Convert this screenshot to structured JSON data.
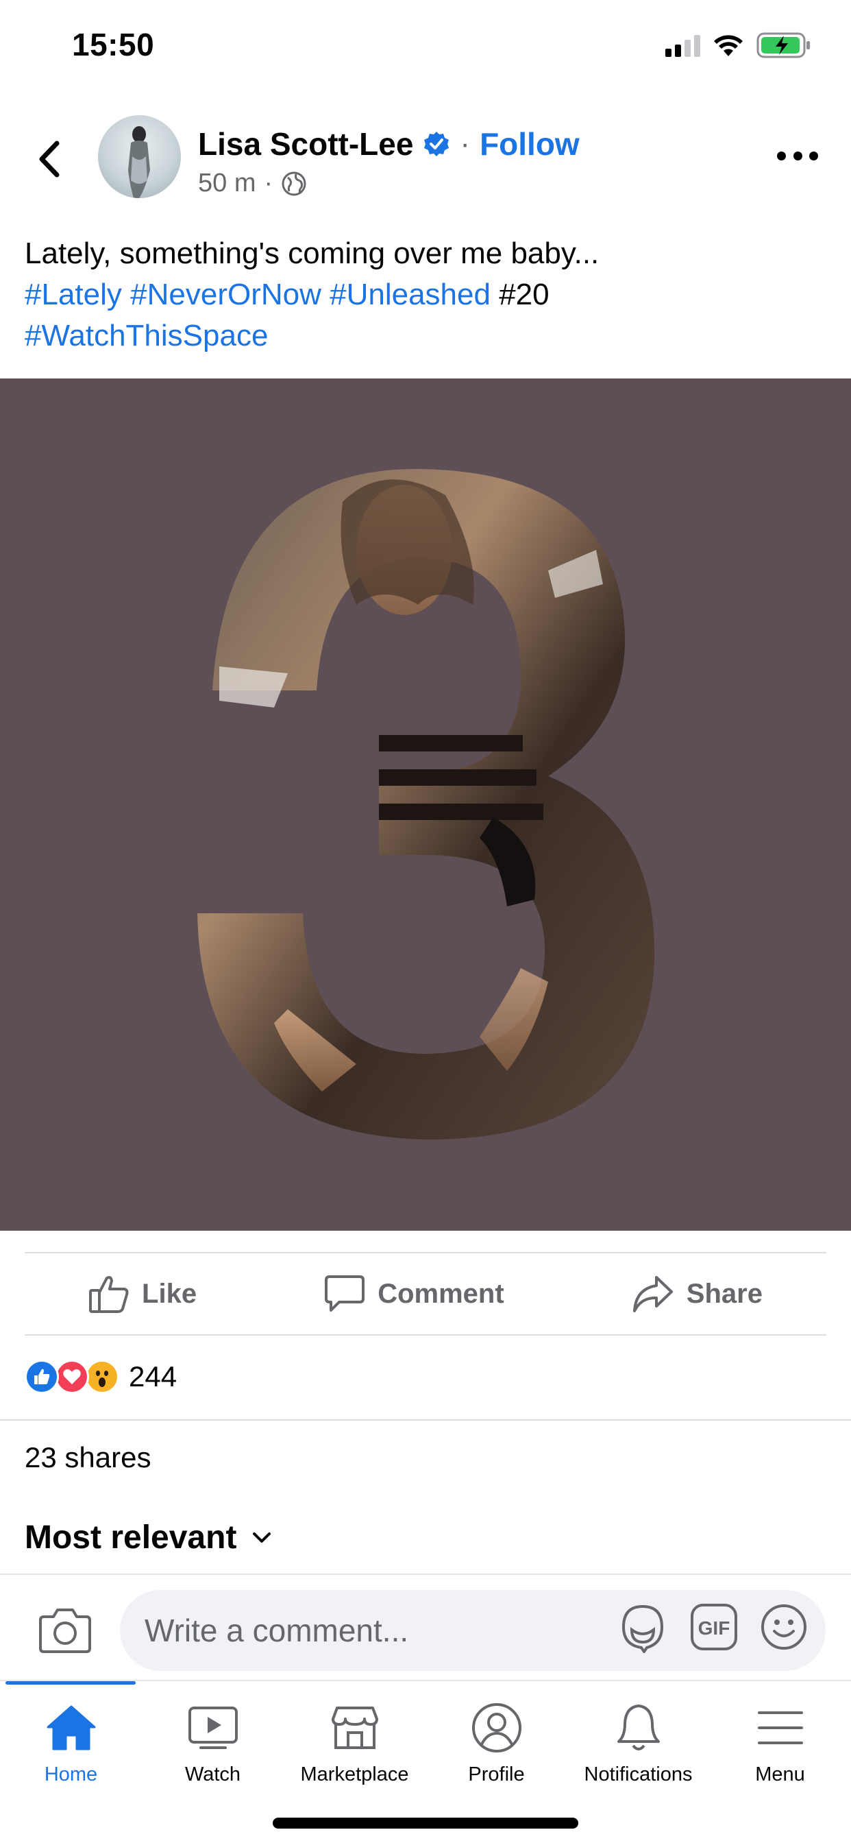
{
  "status_bar": {
    "time": "15:50"
  },
  "post": {
    "author": "Lisa Scott-Lee",
    "verified": true,
    "follow_label": "Follow",
    "time_ago": "50 m",
    "text_line": "Lately, something's coming over me baby...",
    "hashtags": [
      "#Lately",
      "#NeverOrNow",
      "#Unleashed"
    ],
    "plain_tag": "#20",
    "hashtag_last": "#WatchThisSpace",
    "image_background": "#5e4f56"
  },
  "actions": {
    "like": "Like",
    "comment": "Comment",
    "share": "Share"
  },
  "engagement": {
    "reaction_count": "244",
    "shares": "23 shares"
  },
  "comments": {
    "sort_label": "Most relevant",
    "placeholder": "Write a comment..."
  },
  "nav": {
    "items": [
      {
        "label": "Home",
        "icon": "home-icon",
        "active": true
      },
      {
        "label": "Watch",
        "icon": "watch-icon"
      },
      {
        "label": "Marketplace",
        "icon": "marketplace-icon"
      },
      {
        "label": "Profile",
        "icon": "profile-icon"
      },
      {
        "label": "Notifications",
        "icon": "bell-icon"
      },
      {
        "label": "Menu",
        "icon": "menu-icon"
      }
    ]
  },
  "colors": {
    "accent": "#1b74e4",
    "secondary_text": "#65676b",
    "love": "#f33e58",
    "wow": "#f7b125"
  }
}
